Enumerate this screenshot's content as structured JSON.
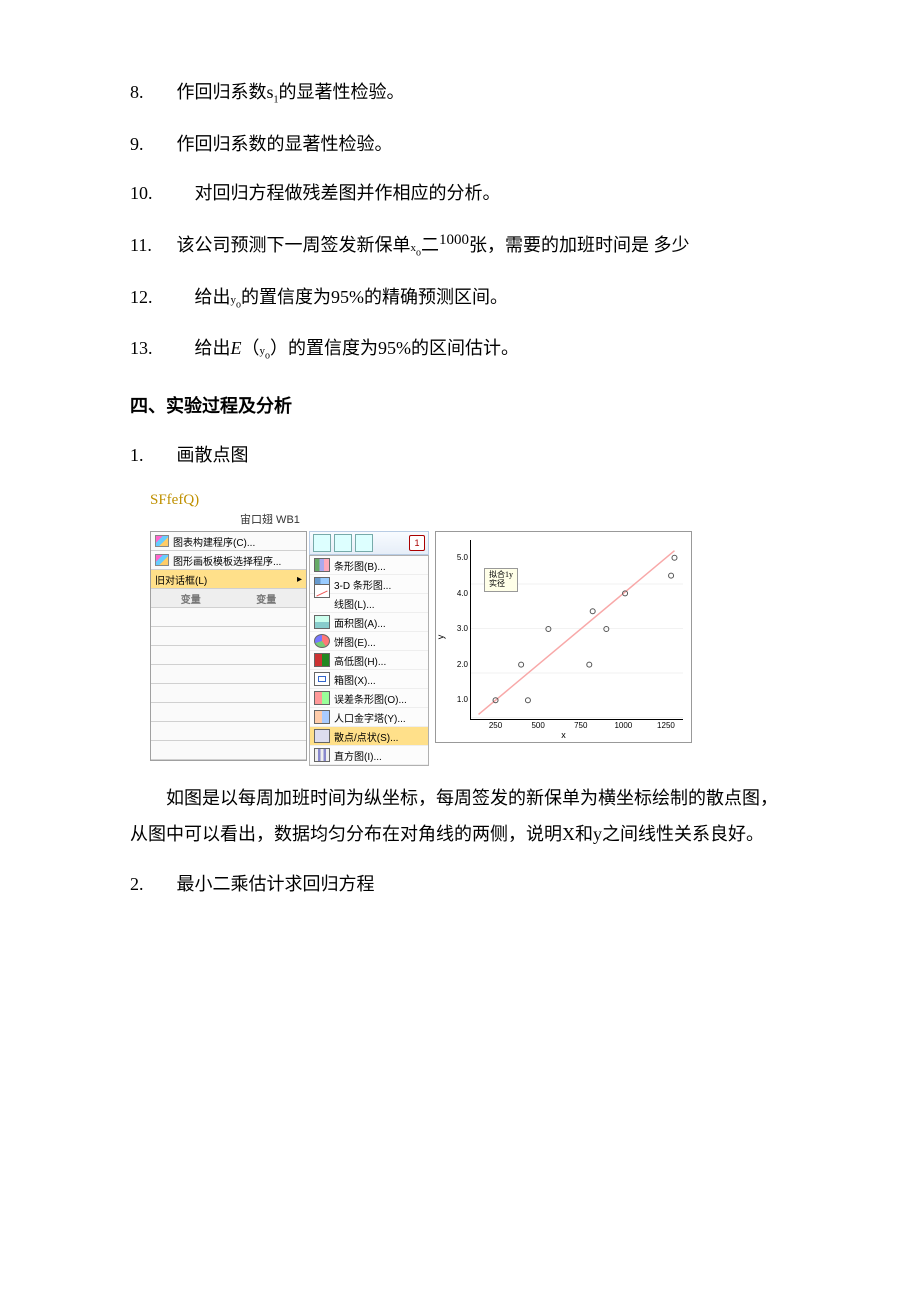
{
  "items": {
    "i8": {
      "num": "8.",
      "text": "作回归系数s",
      "text2": "的显著性检验。",
      "sub": "1"
    },
    "i9": {
      "num": "9.",
      "text": "作回归系数的显著性检验。"
    },
    "i10": {
      "num": "10.",
      "text": "对回归方程做残差图并作相应的分析。"
    },
    "i11": {
      "num": "11.",
      "text_a": "该公司预测下一周签发新保单",
      "xo": "x",
      "osub": "o",
      "eq": "二",
      "sup": "1000",
      "text_b": "张，需要的加班时间是  多少"
    },
    "i12": {
      "num": "12.",
      "text_a": "给出",
      "yo": "y",
      "osub": "o",
      "text_b": "的置信度为95%的精确预测区间。"
    },
    "i13": {
      "num": "13.",
      "text_a": "给出",
      "E": "E",
      "lp": "（",
      "y": "y",
      "osub": "o",
      "rp": "）",
      "text_b": "的置信度为95%的区间估计。"
    }
  },
  "section4": "四、实验过程及分析",
  "step1": {
    "num": "1.",
    "title": "画散点图"
  },
  "step2": {
    "num": "2.",
    "title": "最小二乘估计求回归方程"
  },
  "fig": {
    "sf": "SFfefQ)",
    "wintitle": "宙口翅  WB1",
    "left_rows": {
      "r1": "图表构建程序(C)...",
      "r2": "图形画板模板选择程序...",
      "r3": "旧对话框(L)",
      "h1": "变量",
      "h2": "变量"
    },
    "menu": {
      "m1": "条形图(B)...",
      "m2": "3-D 条形图...",
      "m3": "线图(L)...",
      "m4": "面积图(A)...",
      "m5": "饼图(E)...",
      "m6": "高低图(H)...",
      "m7": "箱图(X)...",
      "m8": "误差条形图(O)...",
      "m9": "人口金字塔(Y)...",
      "m10": "散点/点状(S)...",
      "m11": "直方图(I)..."
    },
    "toolnum": "1"
  },
  "chart_data": {
    "type": "scatter",
    "xlabel": "x",
    "ylabel": "y",
    "xlim": [
      100,
      1350
    ],
    "ylim": [
      0.5,
      5.5
    ],
    "x_ticks": [
      250,
      500,
      750,
      1000,
      1250
    ],
    "y_ticks": [
      1.0,
      2.0,
      3.0,
      4.0,
      5.0
    ],
    "legend": [
      "拟合1y",
      "实径"
    ],
    "fit_line": {
      "x": [
        150,
        1300
      ],
      "y": [
        0.6,
        5.2
      ]
    },
    "points": [
      {
        "x": 250,
        "y": 1.0
      },
      {
        "x": 400,
        "y": 2.0
      },
      {
        "x": 440,
        "y": 1.0
      },
      {
        "x": 560,
        "y": 3.0
      },
      {
        "x": 800,
        "y": 2.0
      },
      {
        "x": 820,
        "y": 3.5
      },
      {
        "x": 900,
        "y": 3.0
      },
      {
        "x": 1010,
        "y": 4.0
      },
      {
        "x": 1280,
        "y": 4.5
      },
      {
        "x": 1300,
        "y": 5.0
      }
    ]
  },
  "paragraph": "如图是以每周加班时间为纵坐标，每周签发的新保单为横坐标绘制的散点图，从图中可以看出，数据均匀分布在对角线的两侧，说明X和y之间线性关系良好。"
}
